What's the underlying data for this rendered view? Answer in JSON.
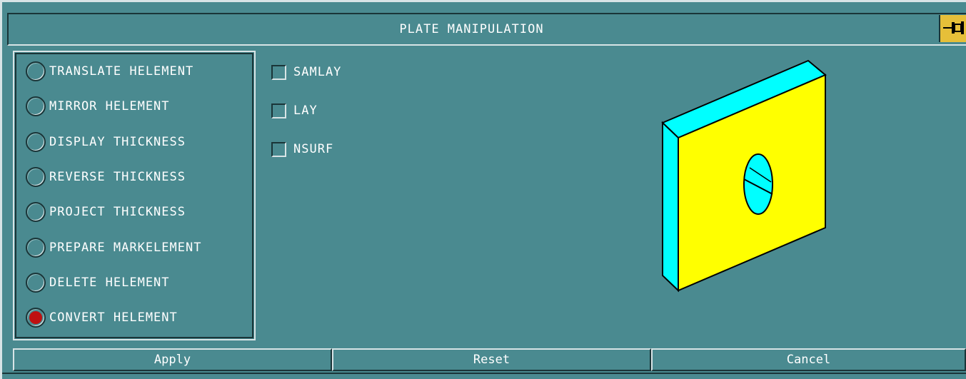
{
  "dialog": {
    "title": "PLATE MANIPULATION",
    "pin_icon": "pushpin-icon"
  },
  "options": {
    "selected_index": 7,
    "items": [
      {
        "label": "TRANSLATE HELEMENT",
        "selected": false
      },
      {
        "label": "MIRROR HELEMENT",
        "selected": false
      },
      {
        "label": "DISPLAY THICKNESS",
        "selected": false
      },
      {
        "label": "REVERSE THICKNESS",
        "selected": false
      },
      {
        "label": "PROJECT THICKNESS",
        "selected": false
      },
      {
        "label": "PREPARE MARKELEMENT",
        "selected": false
      },
      {
        "label": "DELETE HELEMENT",
        "selected": false
      },
      {
        "label": "CONVERT HELEMENT",
        "selected": true
      }
    ]
  },
  "checkboxes": [
    {
      "label": "SAMLAY",
      "checked": false
    },
    {
      "label": "LAY",
      "checked": false
    },
    {
      "label": "NSURF",
      "checked": false
    }
  ],
  "buttons": {
    "apply": "Apply",
    "reset": "Reset",
    "cancel": "Cancel"
  },
  "colors": {
    "background": "#4a8a90",
    "selected_radio": "#bf1010",
    "plate_face": "#ffff00",
    "plate_edge": "#00ffff",
    "pin": "#e6bf39"
  }
}
